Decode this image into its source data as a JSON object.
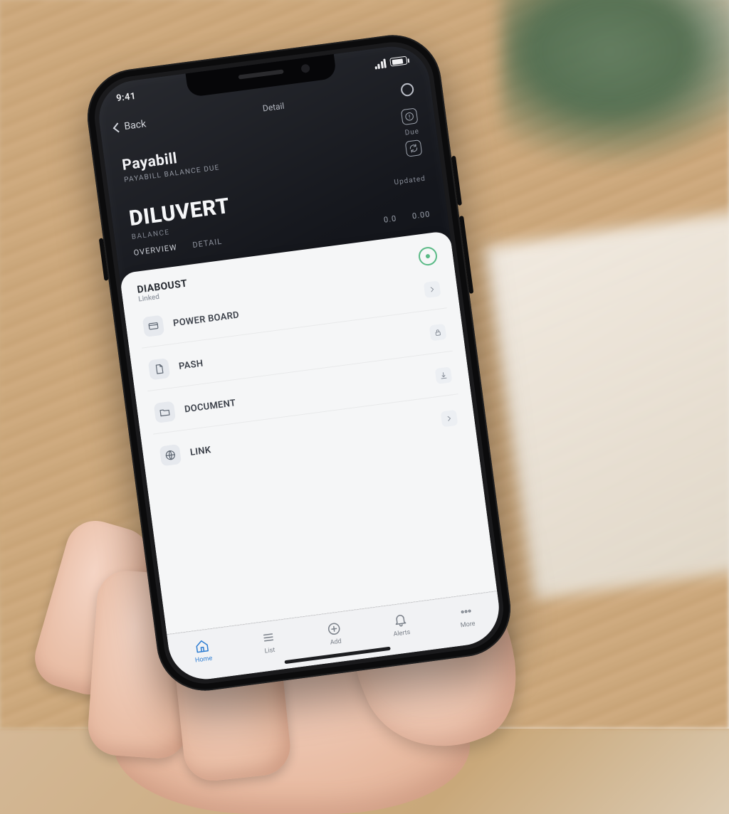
{
  "status_bar": {
    "time": "9:41"
  },
  "nav": {
    "back_label": "Back",
    "title": "Detail"
  },
  "section1": {
    "title": "Payabill",
    "subtitle": "PAYABILL BALANCE DUE",
    "badge": "Due",
    "meta": "Updated"
  },
  "header": {
    "title": "DILUVERT",
    "amount": "0.00",
    "caption": "BALANCE"
  },
  "tabs": {
    "items": [
      {
        "label": "OVERVIEW",
        "active": true
      },
      {
        "label": "DETAIL",
        "active": false
      }
    ],
    "value": "0.0"
  },
  "sheet": {
    "title": "DIABOUST",
    "subtitle": "Linked",
    "items": [
      {
        "label": "POWER BOARD",
        "icon": "card"
      },
      {
        "label": "PASH",
        "icon": "doc"
      },
      {
        "label": "DOCUMENT",
        "icon": "folder"
      },
      {
        "label": "LINK",
        "icon": "globe"
      }
    ]
  },
  "tabbar": {
    "items": [
      {
        "label": "Home",
        "icon": "home",
        "active": true
      },
      {
        "label": "List",
        "icon": "list",
        "active": false
      },
      {
        "label": "Add",
        "icon": "plus",
        "active": false
      },
      {
        "label": "Alerts",
        "icon": "bell",
        "active": false
      },
      {
        "label": "More",
        "icon": "dots",
        "active": false
      }
    ]
  }
}
